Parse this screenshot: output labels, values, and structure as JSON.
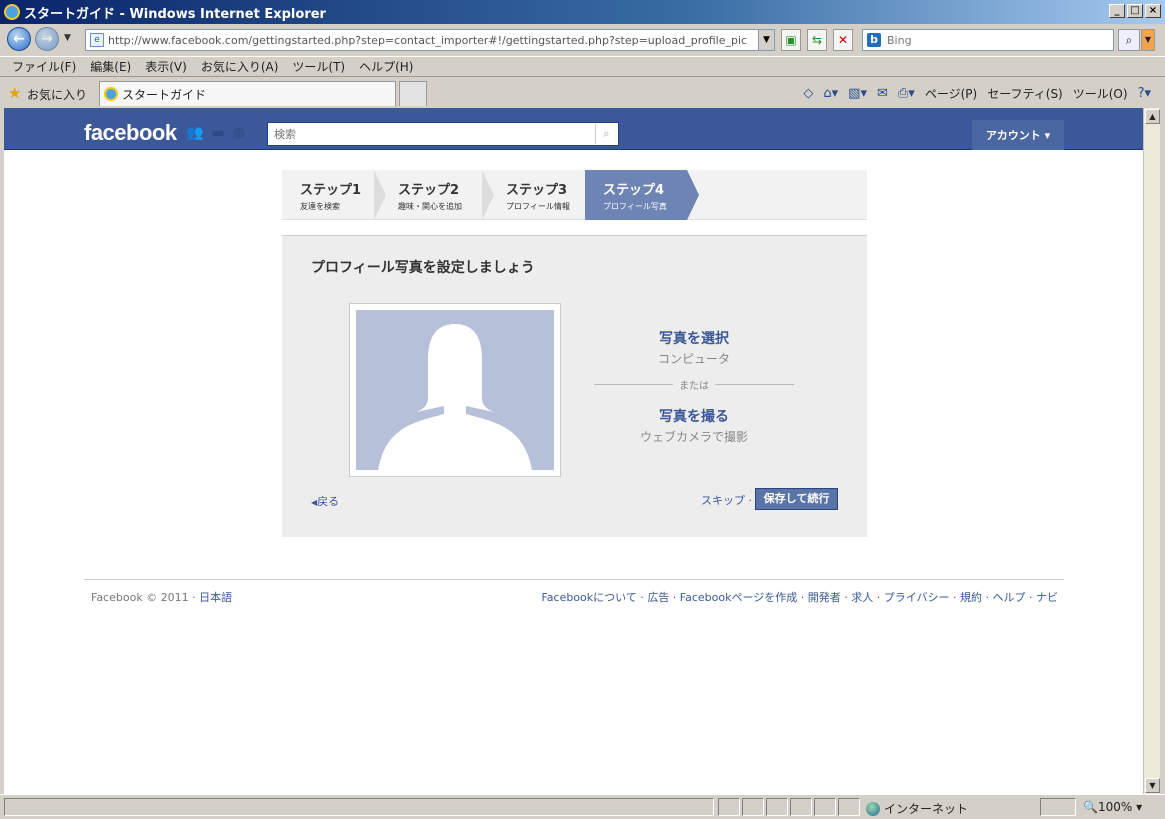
{
  "window": {
    "title": "スタートガイド - Windows Internet Explorer"
  },
  "browser": {
    "url": "http://www.facebook.com/gettingstarted.php?step=contact_importer#!/gettingstarted.php?step=upload_profile_pic",
    "search_placeholder": "Bing",
    "menu": [
      "ファイル(F)",
      "編集(E)",
      "表示(V)",
      "お気に入り(A)",
      "ツール(T)",
      "ヘルプ(H)"
    ],
    "favorites_label": "お気に入り",
    "tab_title": "スタートガイド",
    "commands": {
      "page": "ページ(P)",
      "safety": "セーフティ(S)",
      "tools": "ツール(O)"
    },
    "status": {
      "zone": "インターネット",
      "zoom": "100%"
    }
  },
  "fb": {
    "logo": "facebook",
    "search_placeholder": "検索",
    "account": "アカウント ▾",
    "steps": [
      {
        "title": "ステップ1",
        "desc": "友達を検索"
      },
      {
        "title": "ステップ2",
        "desc": "趣味・関心を追加"
      },
      {
        "title": "ステップ3",
        "desc": "プロフィール情報"
      },
      {
        "title": "ステップ4",
        "desc": "プロフィール写真"
      }
    ],
    "panel": {
      "title": "プロフィール写真を設定しましょう",
      "choose_photo": "写真を選択",
      "choose_photo_sub": "コンピュータ",
      "or": "または",
      "take_photo": "写真を撮る",
      "take_photo_sub": "ウェブカメラで撮影",
      "back": "戻る",
      "skip": "スキップ",
      "save": "保存して続行"
    },
    "footer": {
      "copyright": "Facebook © 2011 · ",
      "language": "日本語",
      "links": "Facebookについて · 広告 · Facebookページを作成 · 開発者 · 求人 · プライバシー · 規約 · ヘルプ · ナビ"
    }
  }
}
